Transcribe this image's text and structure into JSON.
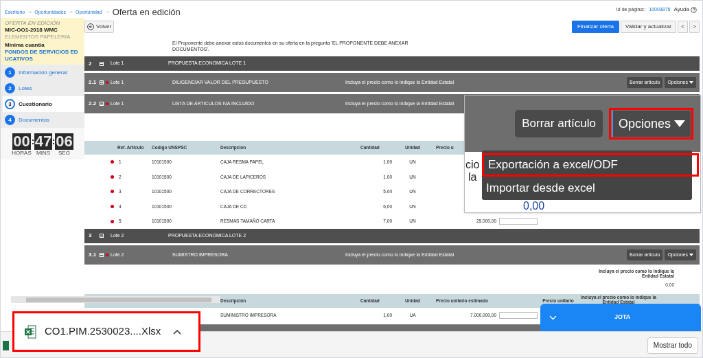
{
  "breadcrumb": {
    "items": [
      "Escritorio",
      "Oportunidades",
      "Oportunidad"
    ],
    "separator": "→",
    "title": "Oferta en edición"
  },
  "page_id": {
    "label": "Id de página::",
    "value": "10003875"
  },
  "help": "Ayuda",
  "offer": {
    "status": "OFERTA EN EDICIÓN",
    "code": "MIC-OO1-2018 WMC",
    "name": "ELEMENTOS PAPELERIA",
    "type": "Mínima cuantía",
    "entity": "FONDOS DE SERVICIOS EDUCATIVOS"
  },
  "steps": [
    {
      "number": "1",
      "label": "Información general",
      "selected": false
    },
    {
      "number": "2",
      "label": "Lotes",
      "selected": false
    },
    {
      "number": "3",
      "label": "Cuestionario",
      "selected": true
    },
    {
      "number": "4",
      "label": "Documentos",
      "selected": false
    }
  ],
  "timer": [
    {
      "value": "00",
      "unit": "HORAS"
    },
    {
      "value": "47",
      "unit": "MINS"
    },
    {
      "value": "06",
      "unit": "SEG"
    }
  ],
  "back_button": "Volver",
  "toolbar": [
    {
      "label": "Finalizar oferta",
      "kind": "primary"
    },
    {
      "label": "Validar y actualizar",
      "kind": "default"
    },
    {
      "label": "<",
      "kind": "nav"
    },
    {
      "label": ">",
      "kind": "nav"
    }
  ],
  "notice": "El Proponente debe anexar estos documentos en su oferta en la pregunta 'EL PROPONENTE DEBE ANEXAR DOCUMENTOS'.",
  "sections": [
    {
      "kind": "group",
      "number": "2",
      "expanded": true,
      "lot": "Lote 1",
      "title": "PROPUESTA ECONOMICA LOTE 1"
    },
    {
      "kind": "item",
      "number": "2.1",
      "expanded": false,
      "marked": true,
      "lot": "Lote 1",
      "title": "DILIGENCIAR VALOR DEL PRESUPUESTO",
      "hint": "Incluya el precio como lo indique la Entidad Estatal",
      "actions": [
        "Borrar artículo",
        "Opciones"
      ]
    },
    {
      "kind": "item",
      "number": "2.2",
      "expanded": true,
      "marked": true,
      "lot": "Lote 1",
      "title": "LISTA DE ARTICULOS IVA INCLUIDO",
      "hint": "Incluya el precio como lo indique la Entidad Estatal"
    },
    {
      "kind": "table",
      "headers": {
        "ref": "Ref. Articulo",
        "code": "Codigo UNSPSC",
        "description": "Descripcion",
        "quantity": "Cantidad",
        "unit": "Unidad",
        "estimated": "Precio u"
      },
      "rows": [
        {
          "marked": true,
          "ref": "1",
          "code": "10101500",
          "description": "CAJA RESMA PAPEL",
          "quantity": "1,00",
          "unit": "UN"
        },
        {
          "marked": true,
          "ref": "2",
          "code": "10101500",
          "description": "CAJA DE LAPICEROS",
          "quantity": "1,00",
          "unit": "UN"
        },
        {
          "marked": true,
          "ref": "3",
          "code": "10101500",
          "description": "CAJA DE CORRECTORES",
          "quantity": "5,00",
          "unit": "UN"
        },
        {
          "marked": true,
          "ref": "4",
          "code": "10101500",
          "description": "CAJA DE CD",
          "quantity": "6,00",
          "unit": "UN"
        },
        {
          "marked": true,
          "ref": "5",
          "code": "10101500",
          "description": "RESMAS TAMAÑO CARTA",
          "quantity": "7,00",
          "unit": "UN",
          "estimated": "25.000,00"
        }
      ]
    },
    {
      "kind": "group",
      "number": "3",
      "expanded": true,
      "lot": "Lote 2",
      "title": "PROPUESTA ECONOMICA LOTE 2"
    },
    {
      "kind": "item",
      "number": "3.1",
      "expanded": true,
      "marked": true,
      "lot": "Lote 2",
      "title": "SUMISTRO IMPRESORA",
      "hint": "Incluya el precio como lo indique la Entidad Estatal",
      "actions": [
        "Borrar artículo",
        "Opciones"
      ]
    },
    {
      "kind": "note",
      "text": "Incluya el precio como lo indique la Entidad Estatal",
      "value": "0,00"
    },
    {
      "kind": "table",
      "headers": {
        "description": "Descripción",
        "quantity": "Cantidad",
        "unit": "Unidad",
        "estimated": "Precio unitario estimado",
        "unit_price": "Precio unitario",
        "note": "Incluya el precio como lo indique la Entidad Estatal"
      },
      "rows": [
        {
          "description": "SUMINISTRO IMPRESORA",
          "quantity": "1,00",
          "unit": "UA",
          "estimated": "7.000.000,00"
        }
      ]
    }
  ],
  "callout": {
    "fragments": [
      "cio",
      "la"
    ],
    "value": "0,00",
    "delete": "Borrar artículo",
    "options": "Opciones",
    "menu": [
      {
        "label": "Exportación a excel/ODF",
        "highlighted": true
      },
      {
        "label": "Importar desde excel",
        "highlighted": false
      }
    ]
  },
  "download": {
    "file": "CO1.PIM.2530023....Xlsx",
    "show_all": "Mostrar todo"
  },
  "chat": {
    "title": "JOTA"
  }
}
